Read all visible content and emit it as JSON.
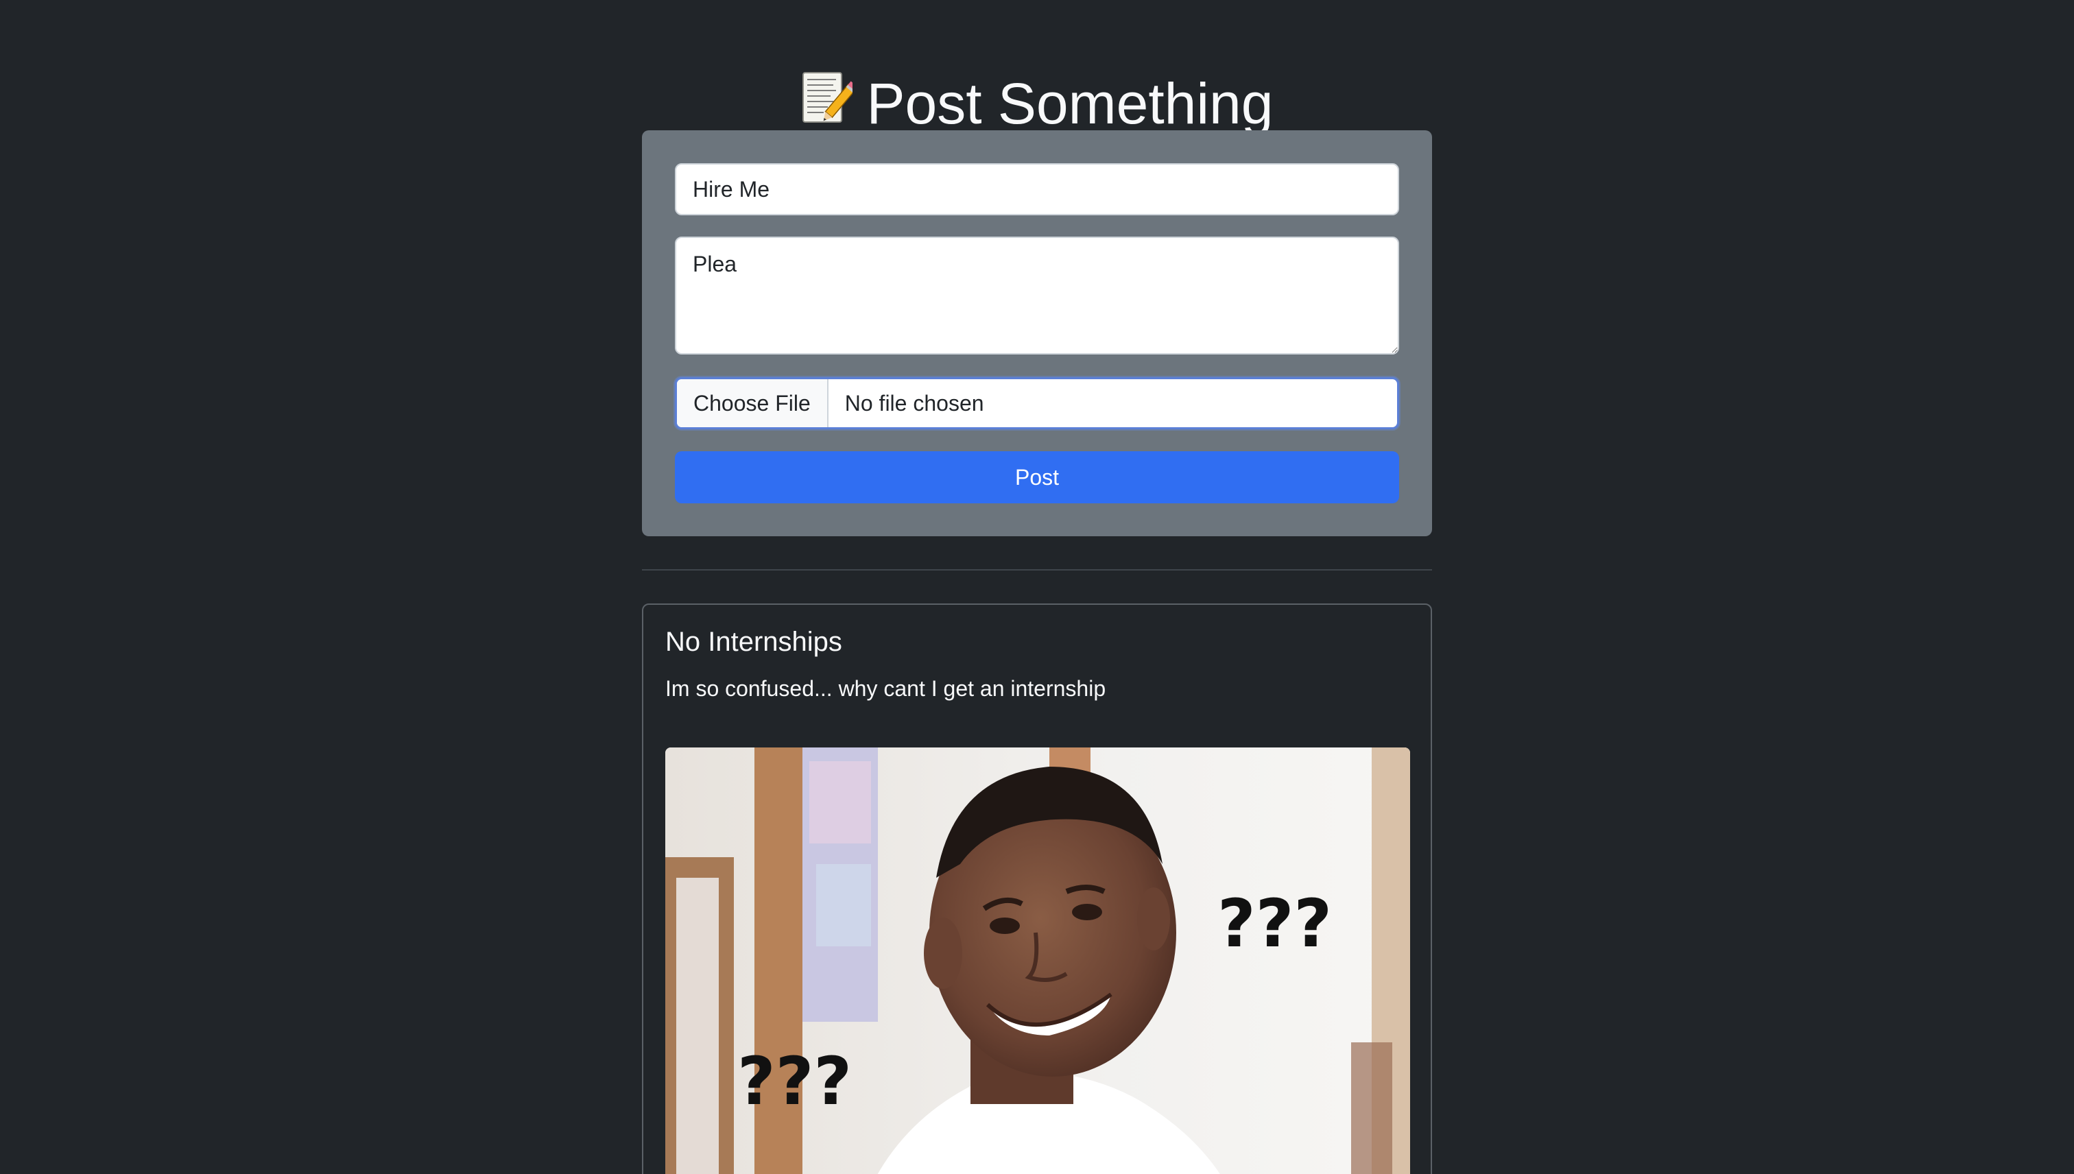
{
  "header": {
    "title": "Post Something",
    "icon": "memo-icon"
  },
  "form": {
    "title_value": "Hire Me",
    "body_value": "Plea",
    "file_button_label": "Choose File",
    "file_status": "No file chosen",
    "submit_label": "Post"
  },
  "posts": [
    {
      "title": "No Internships",
      "body": "Im so confused... why cant I get an internship",
      "image": {
        "description_icon": "confused-man-meme-image",
        "overlay_text_left": "???",
        "overlay_text_right": "???"
      }
    }
  ],
  "colors": {
    "page_background": "#212529",
    "form_background": "#6c757d",
    "accent": "#306ef2",
    "text": "#f8f9fa"
  }
}
